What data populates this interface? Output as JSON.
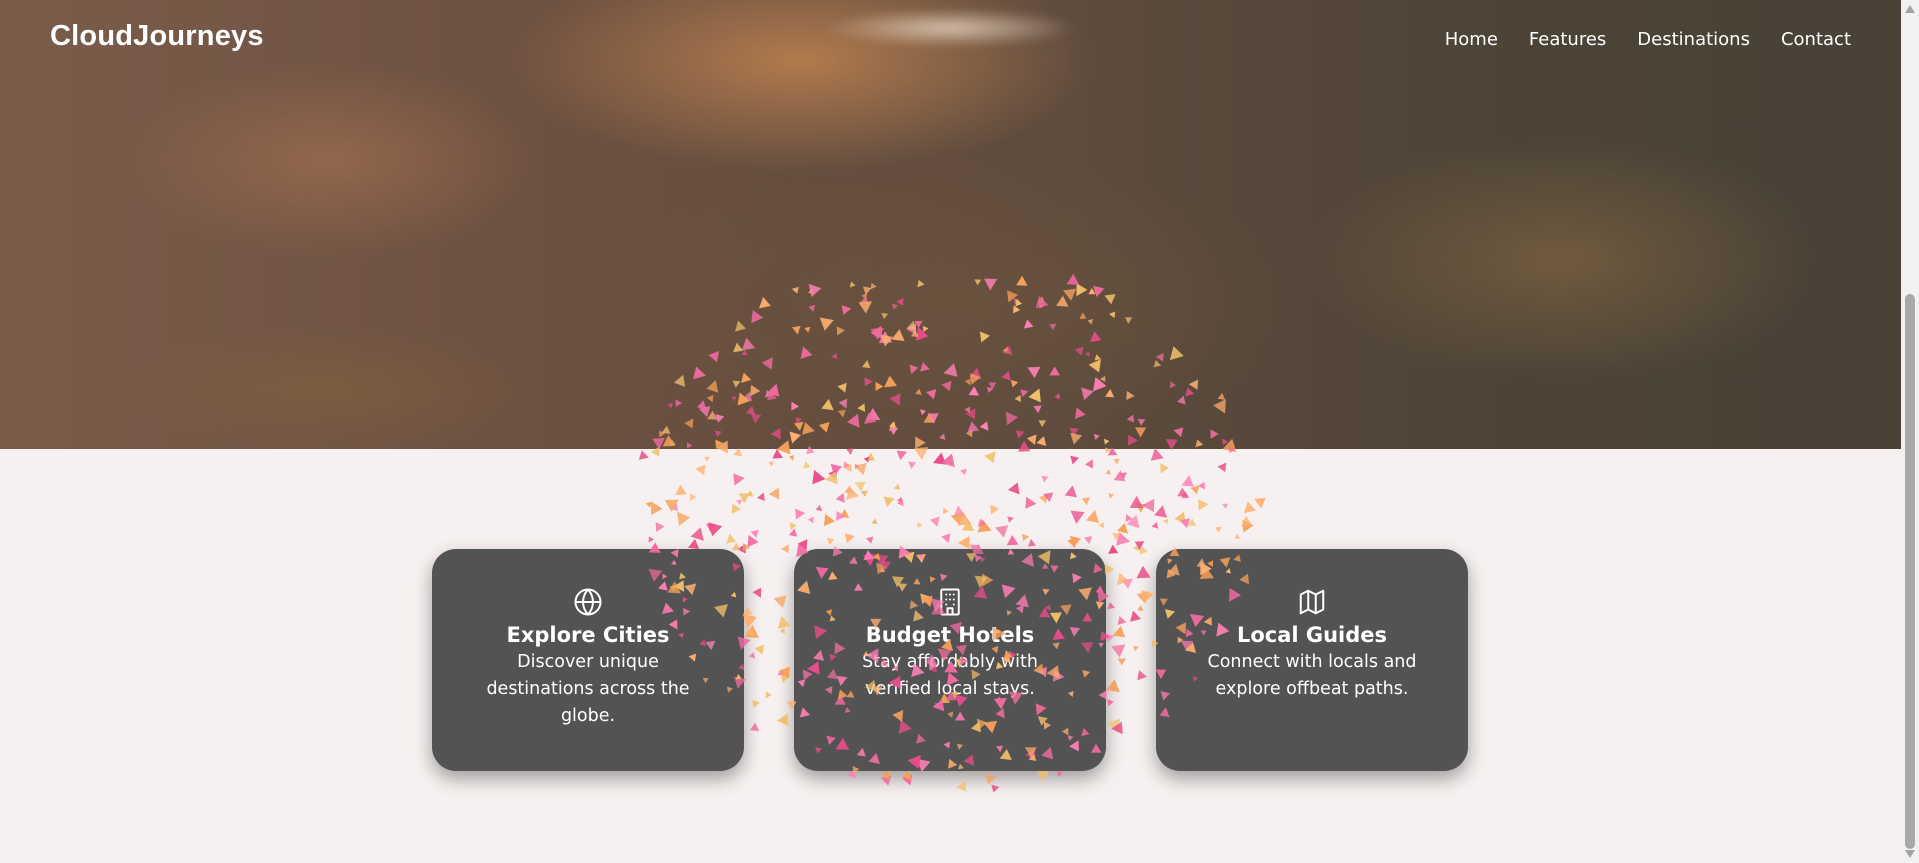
{
  "header": {
    "logo": "CloudJourneys",
    "nav": [
      "Home",
      "Features",
      "Destinations",
      "Contact"
    ]
  },
  "cards": [
    {
      "icon": "globe-icon",
      "title": "Explore Cities",
      "text": "Discover unique destinations across the globe."
    },
    {
      "icon": "hotel-icon",
      "title": "Budget Hotels",
      "text": "Stay affordably with verified local stays."
    },
    {
      "icon": "map-icon",
      "title": "Local Guides",
      "text": "Connect with locals and explore offbeat paths."
    }
  ],
  "colors": {
    "card_background": "#535353",
    "page_background": "#f6f1f0",
    "confetti": [
      "#f06aa0",
      "#f5a05a",
      "#e84d8a",
      "#ffb070",
      "#ff7fb6",
      "#f2c06a"
    ]
  }
}
